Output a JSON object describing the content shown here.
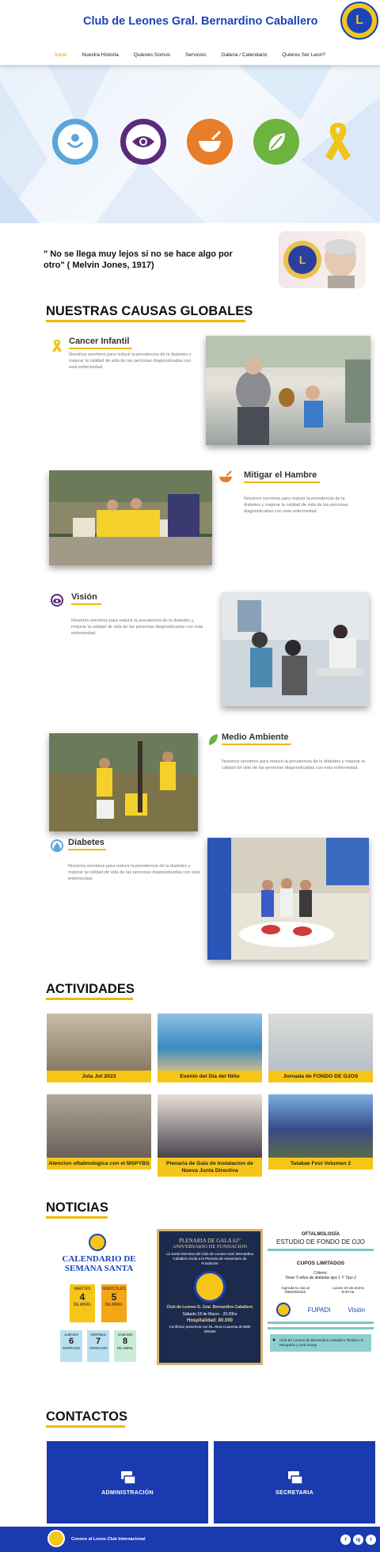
{
  "header": {
    "title": "Club de Leones Gral. Bernardino Caballero",
    "logo_letter": "L",
    "nav": [
      "Inicio",
      "Nuestra Historia",
      "Quienes Somos",
      "Servicios",
      "Galeria / Calendario",
      "Quieres Ser Leon?"
    ]
  },
  "hero": {
    "icons": [
      {
        "name": "hunger-hands-icon",
        "color": "#5aa6dc"
      },
      {
        "name": "vision-eye-icon",
        "color": "#5a2a7e"
      },
      {
        "name": "food-bowl-icon",
        "color": "#e87d2a"
      },
      {
        "name": "environment-leaf-icon",
        "color": "#6db33f"
      },
      {
        "name": "cancer-ribbon-icon",
        "color": "#f0c419"
      }
    ]
  },
  "quote": {
    "text": "\" No se llega muy lejos si no se hace algo por otro\" ( Melvin Jones, 1917)"
  },
  "causes": {
    "title": "NUESTRAS CAUSAS GLOBALES",
    "items": [
      {
        "title": "Cancer Infantil",
        "text": "Nosotros servimos para reducir la prevalencia de la diabetes y mejorar la calidad de vida de las personas diagnosticadas con esta enfermedad."
      },
      {
        "title": "Mitigar el Hambre",
        "text": "Nosotros servimos para reducir la prevalencia de la diabetes y mejorar la calidad de vida de las personas diagnosticadas con esta enfermedad."
      },
      {
        "title": "Visión",
        "text": "Nosotros servimos para reducir la prevalencia de la diabetes y mejorar la calidad de vida de las personas diagnosticadas con esta enfermedad."
      },
      {
        "title": "Medio Ambiente",
        "text": "Nosotros servimos para reducir la prevalencia de la diabetes y mejorar la calidad de vida de las personas diagnosticadas con esta enfermedad."
      },
      {
        "title": "Diabetes",
        "text": "Nosotros servimos para reducir la prevalencia de la diabetes y mejorar la calidad de vida de las personas diagnosticadas con esta enfermedad."
      }
    ]
  },
  "activities": {
    "title": "ACTIVIDADES",
    "items": [
      "Jota Jot 2023",
      "Evento del Día del Niño",
      "Jornada de FONDO DE OJOS",
      "Atencion oftalmologica con el MSPYBS",
      "Plenaria de Gala de Instalacion de Nueva Junta Directiva",
      "Tatakae Fest Volumen 2"
    ]
  },
  "news": {
    "title": "NOTICIAS",
    "calendar": {
      "heading": "CALENDARIO DE SEMANA SANTA",
      "days": [
        {
          "day": "MARTES",
          "num": "4",
          "note": "DE ABRIL"
        },
        {
          "day": "MIERCOLES",
          "num": "5",
          "note": "DE ABRIL"
        },
        {
          "day": "JUEVES",
          "num": "6",
          "note": "CERRADO"
        },
        {
          "day": "VIERNES",
          "num": "7",
          "note": "CERRADO"
        },
        {
          "day": "SABADO",
          "num": "8",
          "note": "DE ABRIL"
        }
      ]
    },
    "gala": {
      "line1": "PLENARIA DE GALA 62°",
      "line2": "ANIVERSARIO DE FUNDACION",
      "line3": "La Junta Directiva del Club de Leones Gral. Bernardino Caballero invita a la Plenaria de Aniversario de Fundación",
      "club": "Club de Leones G. Gral. Bernardino Caballero",
      "date": "Sábado 18 de Marzo · 20:30hs",
      "price": "Hospitalidad: 80.000",
      "confirm": "Confirmar presencia con DL Alma Cuarenta al 0985 295365"
    },
    "oftalmo": {
      "tag": "OFTALMOLOGÍA",
      "title": "ESTUDIO DE FONDO DE OJO",
      "sub": "CUPOS LIMITADOS",
      "criteria_label": "Criterio:",
      "criteria": "Tener 5 años de diabetas tipo 1 Y Tipo 2",
      "agenda": "Agendá tu cita al 0982081022",
      "when": "Lunes 20 de enero 8:00 hs.",
      "partners": [
        "FUPADI",
        "Visión"
      ],
      "address": "Club de Leones de Bernardino Caballero Teodoro S. Mongelós y Gral Garay"
    }
  },
  "contact": {
    "title": "CONTACTOS",
    "boxes": [
      "ADMINISTRACIÓN",
      "SECRETARIA"
    ]
  },
  "footer": {
    "text": "Conoce al Leons Club Internacional",
    "social": [
      "f",
      "ig",
      "t"
    ]
  }
}
